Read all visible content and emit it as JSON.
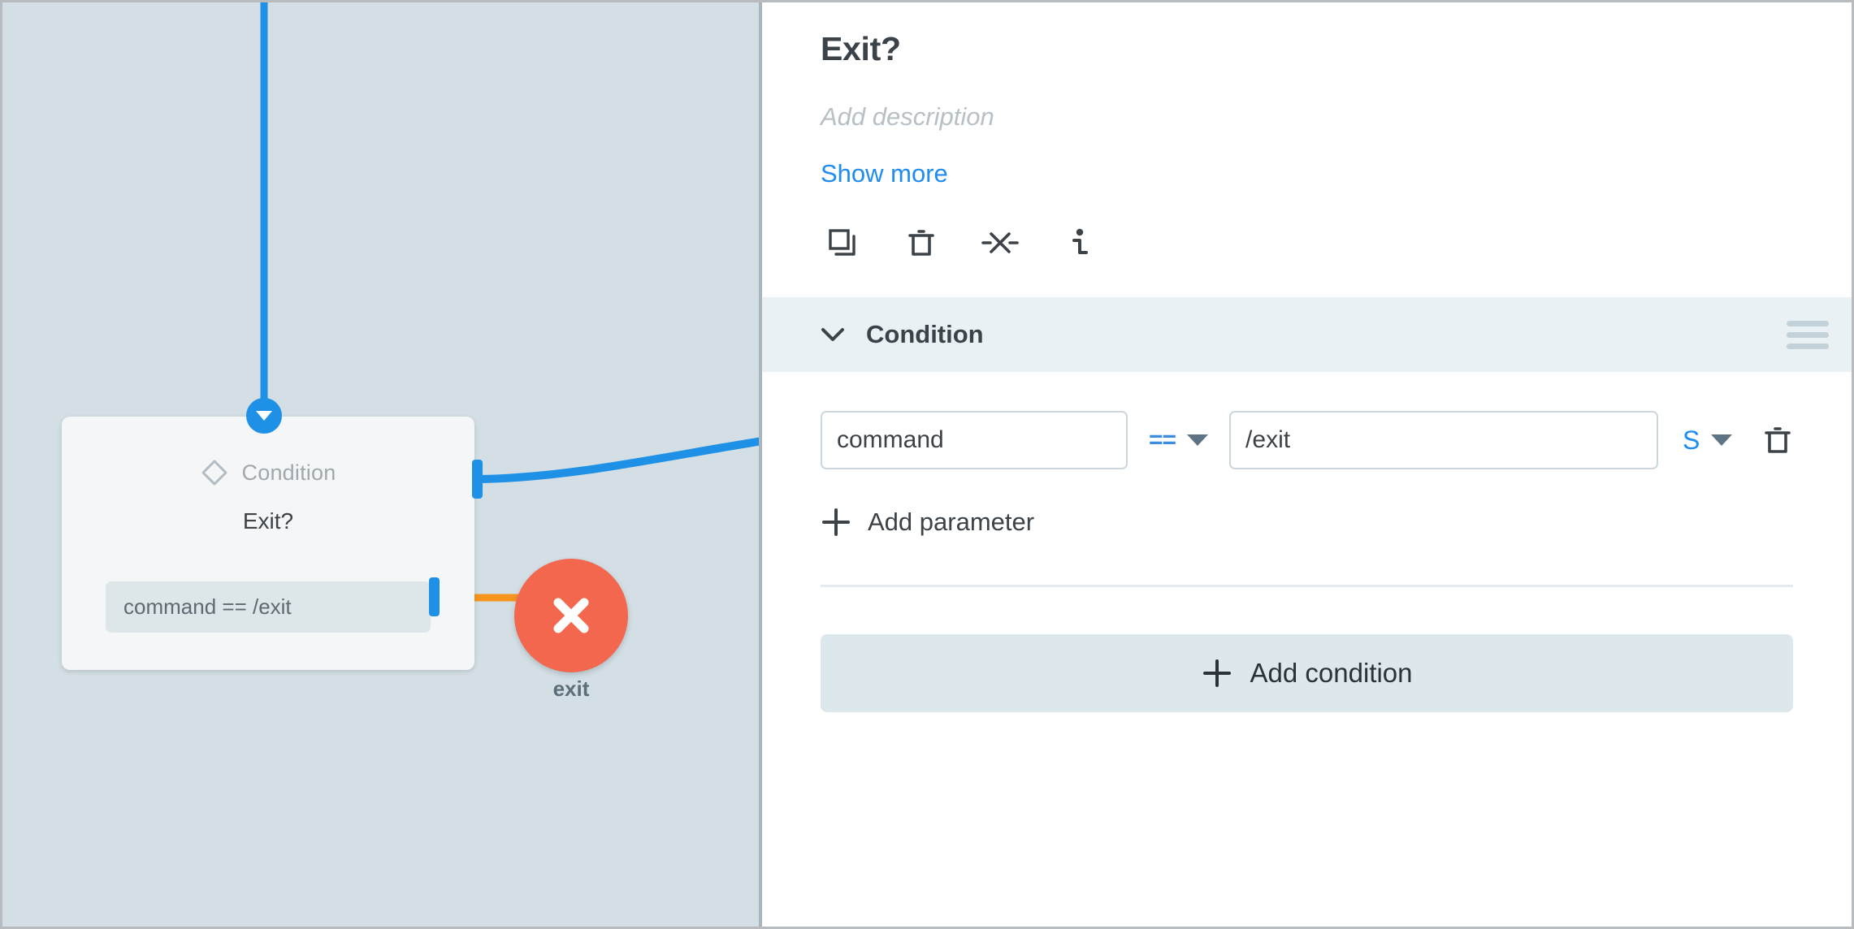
{
  "canvas": {
    "node": {
      "type_label": "Condition",
      "type_icon": "diamond-icon",
      "title": "Exit?",
      "chip_text": "command == /exit"
    },
    "exit_node": {
      "label": "exit",
      "icon": "close-x-icon",
      "color": "#f2674d"
    },
    "colors": {
      "background": "#d3dfe4",
      "edge_blue": "#1e91e6",
      "edge_orange": "#f7941e"
    }
  },
  "panel": {
    "title": "Exit?",
    "description_placeholder": "Add description",
    "show_more_label": "Show more",
    "toolbar": [
      {
        "name": "duplicate-icon",
        "label": "Duplicate"
      },
      {
        "name": "trash-icon",
        "label": "Delete"
      },
      {
        "name": "disconnect-icon",
        "label": "Disconnect"
      },
      {
        "name": "info-icon",
        "label": "Info"
      }
    ],
    "section": {
      "title": "Condition",
      "expanded": true,
      "chevron_icon": "chevron-down-icon",
      "drag_icon": "drag-handle-icon"
    },
    "condition_row": {
      "left_value": "command",
      "left_placeholder": "",
      "operator": "==",
      "right_value": "/exit",
      "right_placeholder": "",
      "type_value": "S",
      "delete_icon": "trash-icon"
    },
    "add_parameter_label": "Add parameter",
    "add_condition_label": "Add condition",
    "colors": {
      "accent_blue": "#1e8cf0",
      "section_bar": "#eaf1f4",
      "add_condition_bg": "#dde8ed"
    }
  }
}
